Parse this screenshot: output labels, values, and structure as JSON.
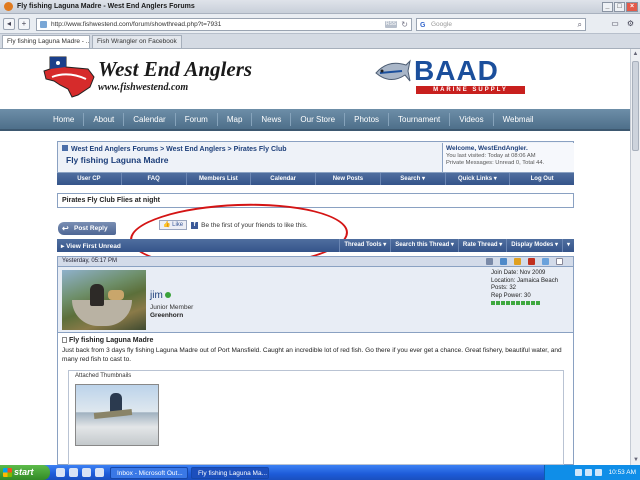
{
  "window": {
    "title": "Fly fishing Laguna Madre - West End Anglers Forums"
  },
  "browser": {
    "url": "http://www.fishwestend.com/forum/showthread.php?t=7931",
    "search_placeholder": "Google",
    "tabs": [
      {
        "label": "Fly fishing Laguna Madre - ..."
      },
      {
        "label": "Fish Wrangler on Facebook"
      }
    ]
  },
  "site": {
    "brand": "West End Anglers",
    "website": "www.fishwestend.com",
    "sponsor_name": "BAAD",
    "sponsor_tagline": "MARINE SUPPLY",
    "nav": [
      "Home",
      "About",
      "Calendar",
      "Forum",
      "Map",
      "News",
      "Our Store",
      "Photos",
      "Tournament",
      "Videos",
      "Webmail"
    ]
  },
  "forum": {
    "breadcrumb": "West End Anglers Forums > West End Anglers > Pirates Fly Club",
    "thread_title": "Fly fishing Laguna Madre",
    "welcome": {
      "line1": "Welcome, WestEndAngler.",
      "line2": "You last visited: Today at 08:06 AM",
      "line3": "Private Messages: Unread 0, Total 44."
    },
    "menu": [
      "User CP",
      "FAQ",
      "Members List",
      "Calendar",
      "New Posts",
      "Search ▾",
      "Quick Links ▾",
      "Log Out"
    ],
    "section_title": "Pirates Fly Club Flies at night",
    "post_reply": "Post Reply",
    "like_button": "Like",
    "like_text": "Be the first of your friends to like this.",
    "thread_tools": {
      "view_first_unread": "View First Unread",
      "items": [
        "Thread Tools ▾",
        "Search this Thread ▾",
        "Rate Thread ▾",
        "Display Modes ▾",
        "▾"
      ]
    },
    "post": {
      "timestamp": "Yesterday, 05:17 PM",
      "username": "jim",
      "user_title": "Junior Member",
      "rank": "Greenhorn",
      "join_date": "Join Date: Nov 2009",
      "location": "Location: Jamaica Beach",
      "posts": "Posts: 32",
      "rep_power": "Rep Power: 30",
      "title": "Fly fishing Laguna Madre",
      "text": "Just back from 3 days fly fishing Laguna Madre out of Port Mansfield. Caught an incredible lot of red fish. Go there if you ever get a chance. Great fishery, beautiful water, and many red fish to cast to.",
      "attachments_label": "Attached Thumbnails"
    }
  },
  "taskbar": {
    "start": "start",
    "tasks": [
      "Inbox - Microsoft Out...",
      "Fly fishing Laguna Ma..."
    ],
    "clock": "10:53 AM"
  },
  "colors": {
    "nav_bg": "#5b7c96",
    "vb_blue": "#3f5e93",
    "annotation_red": "#d41414"
  }
}
